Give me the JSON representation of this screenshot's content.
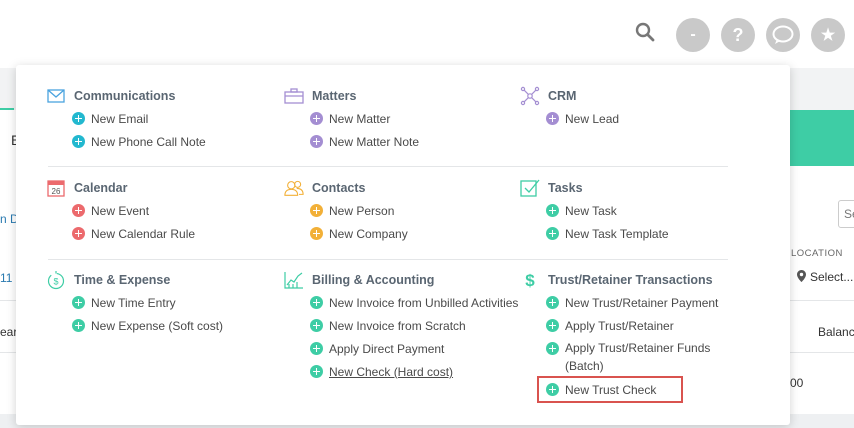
{
  "background": {
    "left_fragments": [
      "E",
      "n De",
      "11",
      "ear"
    ],
    "right_fragments": {
      "search_stub": "Se",
      "location_header": "LOCATION",
      "location_select": "Select...",
      "balance": "Balanc",
      "amount_fragment": "00"
    }
  },
  "topbar": {
    "search_icon": "search-icon",
    "buttons": [
      {
        "icon": "minus-icon",
        "glyph": "-"
      },
      {
        "icon": "help-icon",
        "glyph": "?"
      },
      {
        "icon": "chat-icon"
      },
      {
        "icon": "star-icon",
        "glyph": "★"
      }
    ]
  },
  "menu": {
    "groups": [
      {
        "title": "Communications",
        "icon": "envelope-icon",
        "items": [
          {
            "label": "New Email",
            "color": "#22b8cf"
          },
          {
            "label": "New Phone Call Note",
            "color": "#22b8cf"
          }
        ]
      },
      {
        "title": "Matters",
        "icon": "briefcase-icon",
        "items": [
          {
            "label": "New Matter",
            "color": "#a48ed2"
          },
          {
            "label": "New Matter Note",
            "color": "#a48ed2"
          }
        ]
      },
      {
        "title": "CRM",
        "icon": "network-icon",
        "items": [
          {
            "label": "New Lead",
            "color": "#a48ed2"
          }
        ]
      },
      {
        "title": "Calendar",
        "icon": "calendar-icon",
        "icon_text": "26",
        "items": [
          {
            "label": "New Event",
            "color": "#ec6a6d"
          },
          {
            "label": "New Calendar Rule",
            "color": "#ec6a6d"
          }
        ]
      },
      {
        "title": "Contacts",
        "icon": "contacts-icon",
        "items": [
          {
            "label": "New Person",
            "color": "#f2b038"
          },
          {
            "label": "New Company",
            "color": "#f2b038"
          }
        ]
      },
      {
        "title": "Tasks",
        "icon": "checkbox-icon",
        "items": [
          {
            "label": "New Task",
            "color": "#3ecda5"
          },
          {
            "label": "New Task Template",
            "color": "#3ecda5"
          }
        ]
      },
      {
        "title": "Time & Expense",
        "icon": "stopwatch-dollar-icon",
        "items": [
          {
            "label": "New Time Entry",
            "color": "#3ecda5"
          },
          {
            "label": "New Expense (Soft cost)",
            "color": "#3ecda5"
          }
        ]
      },
      {
        "title": "Billing & Accounting",
        "icon": "line-chart-icon",
        "items": [
          {
            "label": "New Invoice from Unbilled Activities",
            "color": "#3ecda5"
          },
          {
            "label": "New Invoice from Scratch",
            "color": "#3ecda5"
          },
          {
            "label": "Apply Direct Payment",
            "color": "#3ecda5"
          },
          {
            "label": "New Check (Hard cost)",
            "color": "#3ecda5"
          }
        ]
      },
      {
        "title": "Trust/Retainer Transactions",
        "icon": "dollar-icon",
        "items": [
          {
            "label": "New Trust/Retainer Payment",
            "color": "#3ecda5"
          },
          {
            "label": "Apply Trust/Retainer",
            "color": "#3ecda5"
          },
          {
            "label": "Apply Trust/Retainer Funds (Batch)",
            "color": "#3ecda5"
          },
          {
            "label": "New Trust Check",
            "color": "#3ecda5"
          }
        ]
      }
    ],
    "highlighted_item": "New Trust Check",
    "highlight_color": "#d9534f"
  }
}
